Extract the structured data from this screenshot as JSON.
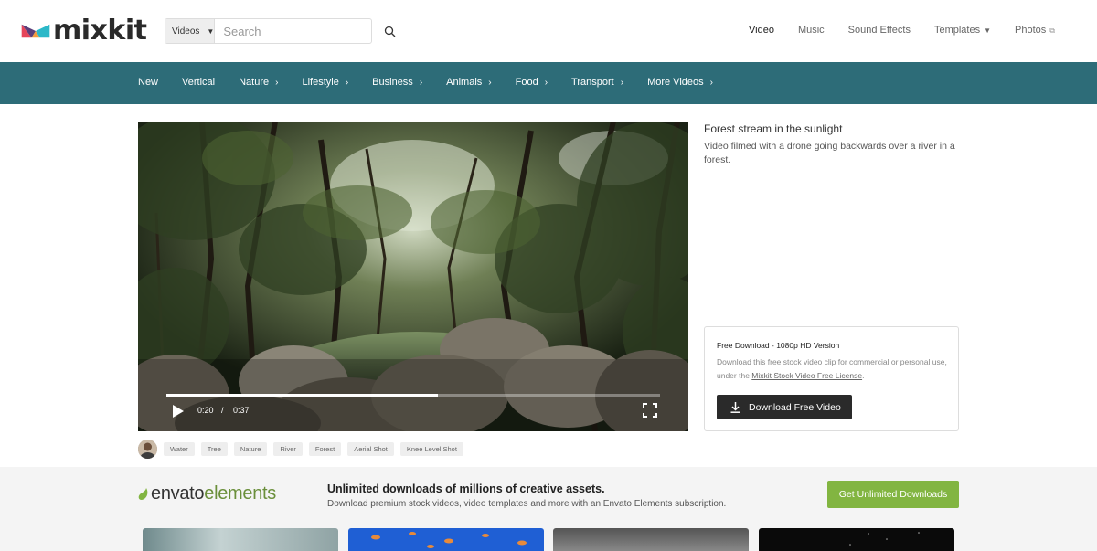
{
  "brand": {
    "name": "mixkit",
    "colors": {
      "primary": "#2d6c78",
      "accent_green": "#82b541",
      "dark": "#2a2a2a"
    }
  },
  "search": {
    "category": "Videos",
    "placeholder": "Search"
  },
  "topnav": {
    "items": [
      {
        "label": "Video",
        "active": true
      },
      {
        "label": "Music"
      },
      {
        "label": "Sound Effects"
      },
      {
        "label": "Templates",
        "dropdown": true
      },
      {
        "label": "Photos",
        "external": true
      }
    ]
  },
  "categories": [
    "New",
    "Vertical",
    "Nature",
    "Lifestyle",
    "Business",
    "Animals",
    "Food",
    "Transport",
    "More Videos"
  ],
  "video": {
    "current_time": "0:20",
    "separator": "/",
    "duration": "0:37",
    "progress": 0.55,
    "title": "Forest stream in the sunlight",
    "description": "Video filmed with a drone going backwards over a river in a forest."
  },
  "download": {
    "heading": "Free Download - 1080p HD Version",
    "text_before": "Download this free stock video clip for commercial or personal use, under the ",
    "license_link": "Mixkit Stock Video Free License",
    "text_after": ".",
    "button_label": "Download Free Video"
  },
  "tags": [
    "Water",
    "Tree",
    "Nature",
    "River",
    "Forest",
    "Aerial Shot",
    "Knee Level Shot"
  ],
  "envato": {
    "logo_main": "envato",
    "logo_light": "elements",
    "headline": "Unlimited downloads of millions of creative assets.",
    "subtext": "Download premium stock videos, video templates and more with an Envato Elements subscription.",
    "button_label": "Get Unlimited Downloads"
  },
  "icons": {
    "search": "search-icon",
    "play": "play-icon",
    "fullscreen": "fullscreen-icon",
    "download": "download-icon"
  }
}
